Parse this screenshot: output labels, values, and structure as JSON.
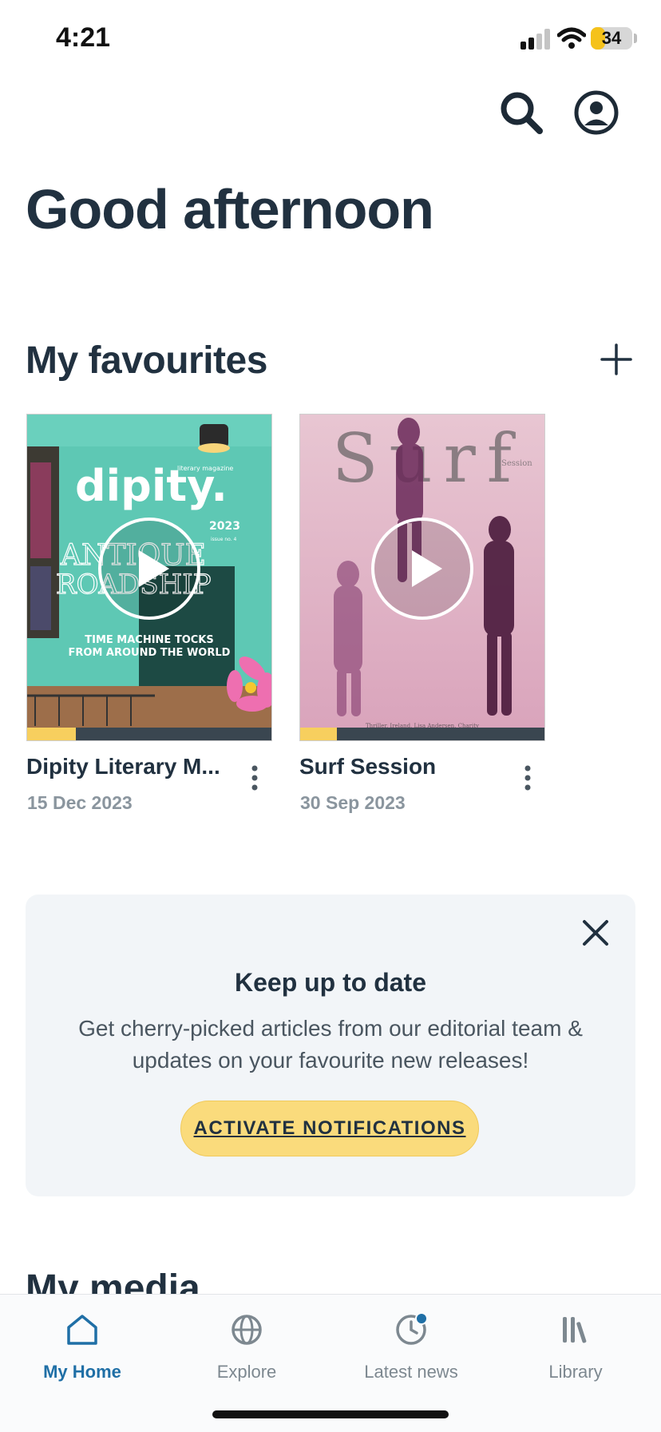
{
  "status_bar": {
    "time": "4:21",
    "battery": "34",
    "battery_level": 0.34
  },
  "header": {
    "greeting": "Good afternoon"
  },
  "favourites": {
    "title": "My favourites",
    "items": [
      {
        "title": "Dipity Literary M...",
        "date": "15 Dec 2023",
        "progress": 0.2
      },
      {
        "title": "Surf Session",
        "date": "30 Sep 2023",
        "progress": 0.15
      }
    ]
  },
  "cover1": {
    "brand": "dipity.",
    "tag": "literary magazine",
    "year": "2023",
    "issue": "issue no. 4",
    "headline_1": "ANTIQUE",
    "headline_2": "ROADSHIP",
    "sub_1": "TIME MACHINE TOCKS",
    "sub_2": "FROM AROUND THE WORLD"
  },
  "cover2": {
    "brand": "Surf",
    "tag": "Session",
    "footer": "Thriller, Ireland, Lisa Andersen, Charity"
  },
  "notification": {
    "title": "Keep up to date",
    "body": "Get cherry-picked articles from our editorial team & updates on your favourite new releases!",
    "cta": "ACTIVATE NOTIFICATIONS"
  },
  "next_section": {
    "title": "My media"
  },
  "bottom_nav": {
    "items": [
      {
        "label": "My Home",
        "icon": "home-icon",
        "active": true
      },
      {
        "label": "Explore",
        "icon": "globe-icon",
        "active": false
      },
      {
        "label": "Latest news",
        "icon": "clock-icon",
        "active": false
      },
      {
        "label": "Library",
        "icon": "library-icon",
        "active": false
      }
    ]
  },
  "colors": {
    "accent": "#1f6fa6",
    "cta": "#fadb7c",
    "progress": "#f7cf5e",
    "heading": "#213140"
  }
}
